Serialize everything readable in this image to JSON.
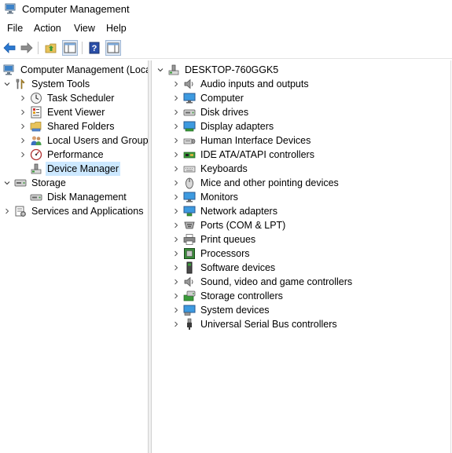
{
  "window": {
    "title": "Computer Management"
  },
  "menu": [
    {
      "label": "File"
    },
    {
      "label": "Action"
    },
    {
      "label": "View"
    },
    {
      "label": "Help"
    }
  ],
  "toolbar": {
    "buttons": [
      {
        "icon": "back-arrow-icon"
      },
      {
        "icon": "forward-arrow-icon"
      },
      {
        "icon": "up-folder-icon"
      },
      {
        "icon": "show-hide-console-tree-icon"
      },
      {
        "icon": "help-icon"
      },
      {
        "icon": "show-hide-action-pane-icon"
      }
    ]
  },
  "tree": {
    "root": {
      "label": "Computer Management (Local",
      "icon": "computer-management-icon"
    },
    "items": [
      {
        "label": "System Tools",
        "icon": "tools-icon"
      },
      {
        "label": "Task Scheduler",
        "icon": "clock-icon"
      },
      {
        "label": "Event Viewer",
        "icon": "event-viewer-icon"
      },
      {
        "label": "Shared Folders",
        "icon": "shared-folder-icon"
      },
      {
        "label": "Local Users and Groups",
        "icon": "users-icon"
      },
      {
        "label": "Performance",
        "icon": "performance-icon"
      },
      {
        "label": "Device Manager",
        "icon": "device-manager-icon"
      },
      {
        "label": "Storage",
        "icon": "storage-icon"
      },
      {
        "label": "Disk Management",
        "icon": "disk-management-icon"
      },
      {
        "label": "Services and Applications",
        "icon": "services-icon"
      }
    ]
  },
  "devices": {
    "computer_name": "DESKTOP-760GGK5",
    "categories": [
      {
        "label": "Audio inputs and outputs",
        "icon": "speaker-icon"
      },
      {
        "label": "Computer",
        "icon": "monitor-icon"
      },
      {
        "label": "Disk drives",
        "icon": "disk-drive-icon"
      },
      {
        "label": "Display adapters",
        "icon": "display-adapter-icon"
      },
      {
        "label": "Human Interface Devices",
        "icon": "hid-icon"
      },
      {
        "label": "IDE ATA/ATAPI controllers",
        "icon": "ide-controller-icon"
      },
      {
        "label": "Keyboards",
        "icon": "keyboard-icon"
      },
      {
        "label": "Mice and other pointing devices",
        "icon": "mouse-icon"
      },
      {
        "label": "Monitors",
        "icon": "monitor-icon"
      },
      {
        "label": "Network adapters",
        "icon": "network-adapter-icon"
      },
      {
        "label": "Ports (COM & LPT)",
        "icon": "port-icon"
      },
      {
        "label": "Print queues",
        "icon": "printer-icon"
      },
      {
        "label": "Processors",
        "icon": "processor-icon"
      },
      {
        "label": "Software devices",
        "icon": "software-device-icon"
      },
      {
        "label": "Sound, video and game controllers",
        "icon": "speaker-icon"
      },
      {
        "label": "Storage controllers",
        "icon": "storage-controller-icon"
      },
      {
        "label": "System devices",
        "icon": "system-device-icon"
      },
      {
        "label": "Universal Serial Bus controllers",
        "icon": "usb-icon"
      }
    ]
  }
}
